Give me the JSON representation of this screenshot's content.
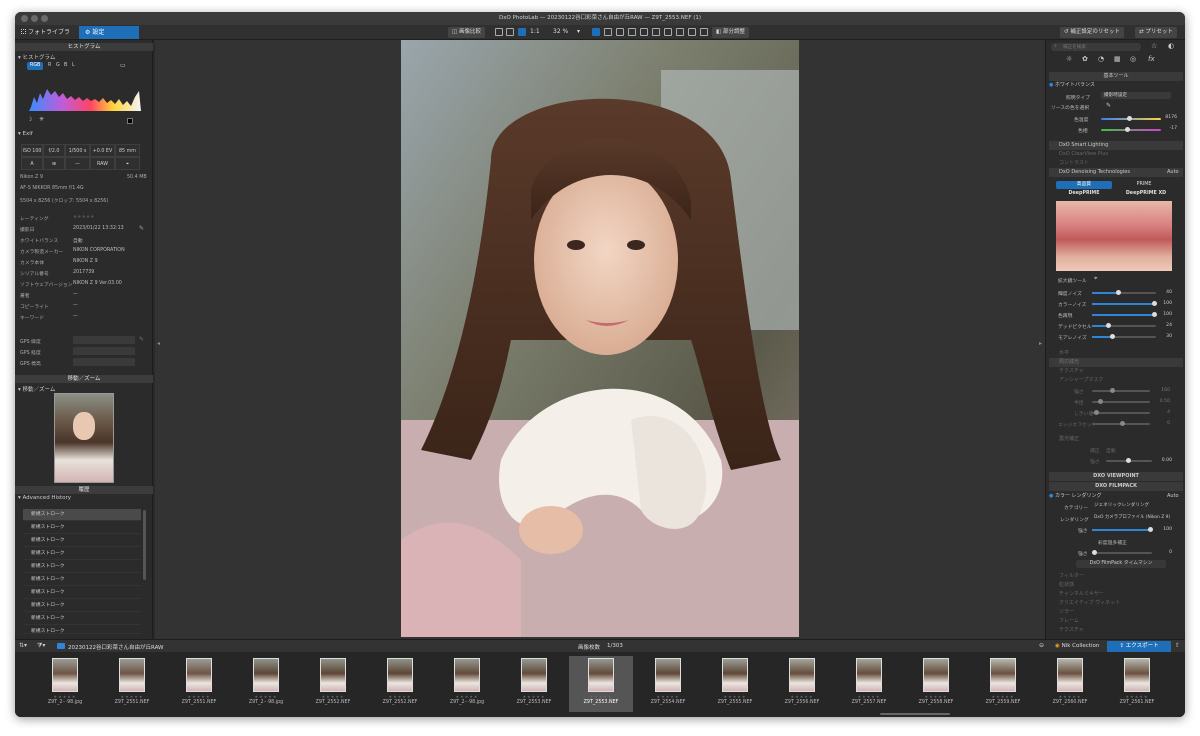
{
  "window_title": "DxO PhotoLab — 20230122谷口彩菜さん自由が丘RAW — Z9T_2553.NEF (1)",
  "tabs": [
    {
      "label": "フォトライブラリ"
    },
    {
      "label": "設定"
    }
  ],
  "toolbar": {
    "compare_label": "画像比較",
    "one_to_one": "1:1",
    "zoom": "32 %",
    "fine_adjust": "部分調整",
    "reset_label": "補正設定のリセット",
    "preset_label": "プリセット"
  },
  "left": {
    "histogram_title": "ヒストグラム",
    "histogram_sub": "ヒストグラム",
    "channels": [
      "RGB",
      "R",
      "G",
      "B",
      "L"
    ],
    "exif_title": "Exif",
    "exif_cells": [
      "ISO 100",
      "f/2.0",
      "1/500 s",
      "+0.0 EV",
      "85 mm",
      "A",
      "",
      "—",
      "RAW",
      ""
    ],
    "camera": "Nikon Z 9",
    "file_size": "50.4 MB",
    "lens": "AF-S NIKKOR 85mm f/1.4G",
    "dimensions": "5504 x 8256 (クロップ: 5504 x 8256)",
    "meta": [
      {
        "label": "レーティング",
        "value": "★★★★★"
      },
      {
        "label": "撮影日",
        "value": "2023/01/22 13:32:13"
      },
      {
        "label": "ホワイトバランス",
        "value": "自動"
      },
      {
        "label": "カメラ製造メーカー",
        "value": "NIKON CORPORATION"
      },
      {
        "label": "カメラ本体",
        "value": "NIKON Z 9"
      },
      {
        "label": "シリアル番号",
        "value": "2017739"
      },
      {
        "label": "ソフトウェアバージョン",
        "value": "NIKON Z 9 Ver.03.00"
      },
      {
        "label": "著者",
        "value": "—"
      },
      {
        "label": "コピーライト",
        "value": "—"
      },
      {
        "label": "キーワード",
        "value": "—"
      }
    ],
    "gps": [
      {
        "label": "GPS 緯度"
      },
      {
        "label": "GPS 経度"
      },
      {
        "label": "GPS 標高"
      }
    ],
    "move_zoom_title": "移動／ズーム",
    "move_zoom_sub": "移動／ズーム",
    "history_title": "履歴",
    "history_sub": "Advanced History",
    "history_items": [
      "新規ストローク",
      "新規ストローク",
      "新規ストローク",
      "新規ストローク",
      "新規ストローク",
      "新規ストローク",
      "新規ストローク",
      "新規ストローク",
      "新規ストローク",
      "新規ストローク"
    ]
  },
  "right": {
    "search_placeholder": "補正を検索",
    "basic_tools": "基本ツール",
    "white_balance": "ホワイトバランス",
    "preset_type_label": "照明タイプ",
    "preset_type_value": "撮影時設定",
    "source_select": "ソースの色を選択",
    "temp_label": "色温度",
    "temp_value": "8176",
    "tint_label": "色相",
    "tint_value": "-17",
    "smart_lighting": "DxO Smart Lighting",
    "clearview": "DxO ClearView Plus",
    "contrast": "コントラスト",
    "denoise": "DxO Denoising Technologies",
    "denoise_mode": "Auto",
    "hq_label": "高品質",
    "prime_label": "PRIME",
    "deepprime_label": "DeepPRIME",
    "deepprime_xd_label": "DeepPRIME XD",
    "magnifier": "拡大鏡ツール",
    "noise_sliders": [
      {
        "label": "輝度ノイズ",
        "value": "40",
        "pct": 0.4
      },
      {
        "label": "カラーノイズ",
        "value": "100",
        "pct": 1.0
      },
      {
        "label": "色再現",
        "value": "100",
        "pct": 1.0
      },
      {
        "label": "デッドピクセル",
        "value": "24",
        "pct": 0.24
      },
      {
        "label": "モアレノイズ",
        "value": "30",
        "pct": 0.3
      }
    ],
    "horizon": "水平",
    "vignetting": "周辺減光",
    "texture": "テクスチャ",
    "unsharp": "アンシャープマスク",
    "unsharp_sliders": [
      {
        "label": "強さ",
        "value": "160",
        "pct": 0.32
      },
      {
        "label": "半径",
        "value": "0.50",
        "pct": 0.1
      },
      {
        "label": "しきい値",
        "value": "4",
        "pct": 0.04
      },
      {
        "label": "エッジオフセット",
        "value": "0",
        "pct": 0.5
      }
    ],
    "exposure": "露光補正",
    "exposure_mode_label": "補正",
    "exposure_mode_value": "自動",
    "exposure_strength_label": "強さ",
    "exposure_value": "0.00",
    "exposure_pct": 0.5,
    "viewpoint": "DXO VIEWPOINT",
    "filmpack": "DXO FILMPACK",
    "color_rendering": "カラー レンダリング",
    "color_rendering_mode": "Auto",
    "category_label": "カテゴリー",
    "category_value": "ジェネリックレンダリング",
    "rendering_label": "レンダリング",
    "rendering_value": "DxO カメラプロファイル (Nikon Z 9)",
    "intensity_label": "強さ",
    "intensity_value": "100",
    "intensity_pct": 1.0,
    "protect_label": "彩度過多補正",
    "protect_strength_label": "強さ",
    "protect_value": "0",
    "timemachine": "DxO FilmPack タイムマシン",
    "filmpack_items": [
      "フィルター",
      "粒状感",
      "チャンネルミキサー",
      "クリエイティブ ヴィネット",
      "ソラー",
      "フレーム",
      "テクスチャ"
    ]
  },
  "bottom": {
    "folder": "20230122谷口彩菜さん自由が丘RAW",
    "count_label": "画像枚数",
    "count": "1/303",
    "nik": "Nik Collection",
    "export": "エクスポート"
  },
  "thumbs": [
    {
      "name": "Z9T_2···98.jpg"
    },
    {
      "name": "Z9T_2551.NEF"
    },
    {
      "name": "Z9T_2551.NEF"
    },
    {
      "name": "Z9T_2···98.jpg"
    },
    {
      "name": "Z9T_2552.NEF"
    },
    {
      "name": "Z9T_2552.NEF"
    },
    {
      "name": "Z9T_2···98.jpg"
    },
    {
      "name": "Z9T_2553.NEF"
    },
    {
      "name": "Z9T_2553.NEF"
    },
    {
      "name": "Z9T_2554.NEF"
    },
    {
      "name": "Z9T_2555.NEF"
    },
    {
      "name": "Z9T_2556.NEF"
    },
    {
      "name": "Z9T_2557.NEF"
    },
    {
      "name": "Z9T_2558.NEF"
    },
    {
      "name": "Z9T_2559.NEF"
    },
    {
      "name": "Z9T_2560.NEF"
    },
    {
      "name": "Z9T_2561.NEF"
    }
  ],
  "colors": {
    "accent": "#1e6fb8",
    "panel": "#2b2b2b",
    "viewer": "#333333"
  }
}
